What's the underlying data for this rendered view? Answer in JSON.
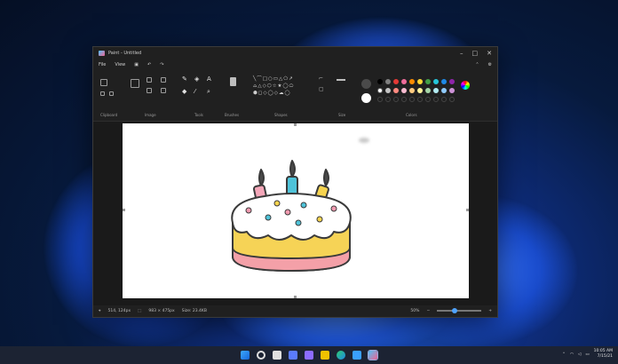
{
  "window": {
    "title": "Paint - Untitled",
    "minimize": "–",
    "maximize": "□",
    "close": "✕"
  },
  "menu": {
    "file": "File",
    "view": "View",
    "save_icon": "save-icon",
    "undo_icon": "undo-icon",
    "redo_icon": "redo-icon"
  },
  "ribbon": {
    "groups": [
      "Clipboard",
      "Image",
      "Tools",
      "Brushes",
      "Shapes",
      "Size",
      "Colors"
    ]
  },
  "colors": {
    "row1": [
      "#000000",
      "#7f7f7f",
      "#e53935",
      "#ef6c9a",
      "#fb8c00",
      "#fdd835",
      "#43a047",
      "#26c6da",
      "#1e88e5",
      "#8e24aa"
    ],
    "row2": [
      "#ffffff",
      "#c3c3c3",
      "#ff8a80",
      "#f8bbd0",
      "#ffcc80",
      "#fff59d",
      "#a5d6a7",
      "#b2ebf2",
      "#90caf9",
      "#ce93d8"
    ]
  },
  "status": {
    "cursor": "514, 124px",
    "selection": "983 × 475px",
    "size": "Size: 23.4KB",
    "zoom": "50%",
    "zoom_level": 0.38
  },
  "tray": {
    "time": "10:05 AM",
    "date": "7/15/21"
  }
}
